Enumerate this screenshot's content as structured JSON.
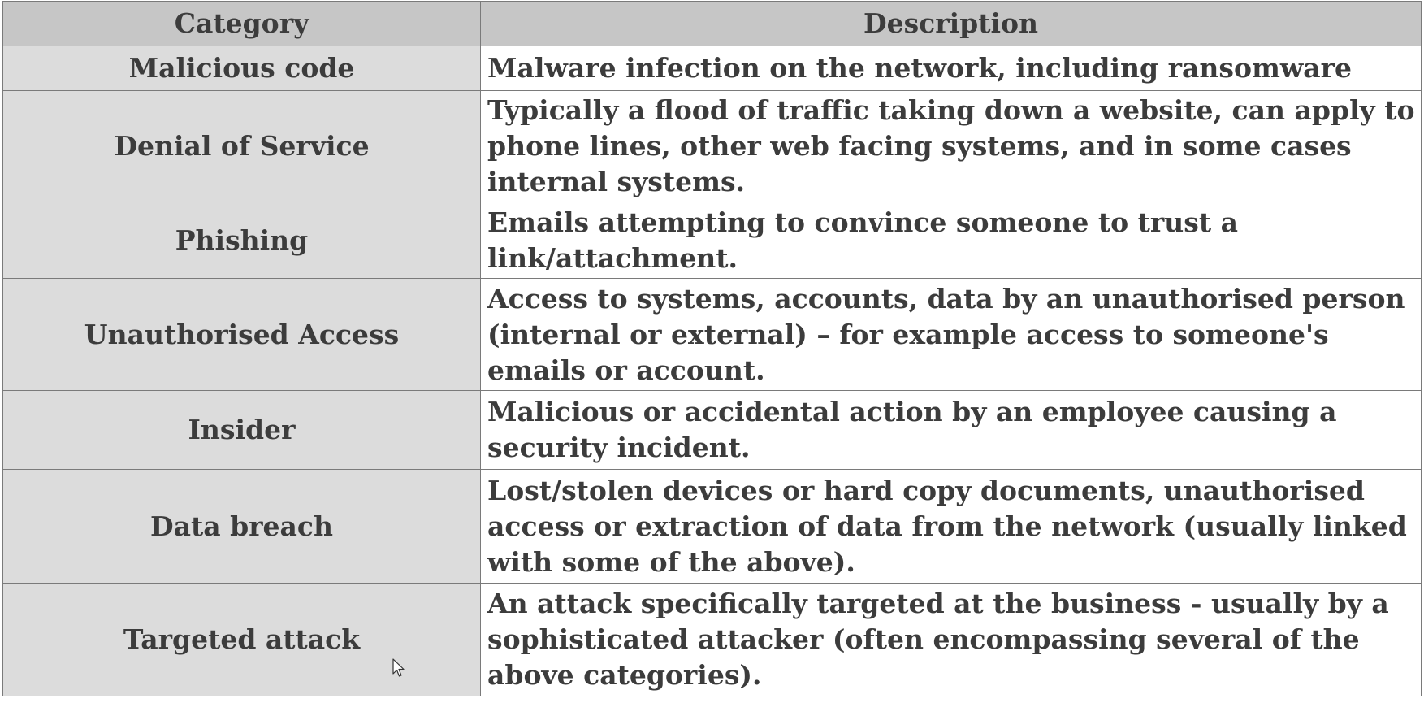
{
  "table": {
    "headers": {
      "category": "Category",
      "description": "Description"
    },
    "rows": [
      {
        "category": "Malicious code",
        "description": "Malware infection on the network, including ransomware"
      },
      {
        "category": "Denial of Service",
        "description": "Typically a flood of traffic taking down a website, can apply to phone lines, other web facing systems, and in some cases internal systems."
      },
      {
        "category": "Phishing",
        "description": "Emails attempting to convince someone to trust a link/attachment."
      },
      {
        "category": "Unauthorised Access",
        "description": "Access to systems, accounts, data by an unauthorised person (internal or external) – for example access to someone's emails or account."
      },
      {
        "category": "Insider",
        "description": "Malicious or accidental action by an employee causing a security incident."
      },
      {
        "category": "Data breach",
        "description": "Lost/stolen devices or hard copy documents, unauthorised access or extraction of data from the network (usually linked with some of the above)."
      },
      {
        "category": "Targeted attack",
        "description": "An attack specifically targeted at the business - usually by a sophisticated attacker (often encompassing several of the above categories)."
      }
    ]
  },
  "colors": {
    "header_bg": "#c6c6c6",
    "category_bg": "#dcdcdc",
    "description_bg": "#ffffff",
    "text": "#3c3c3c",
    "border": "#7a7a7a"
  },
  "icons": {
    "cursor": "mouse-pointer-icon"
  }
}
